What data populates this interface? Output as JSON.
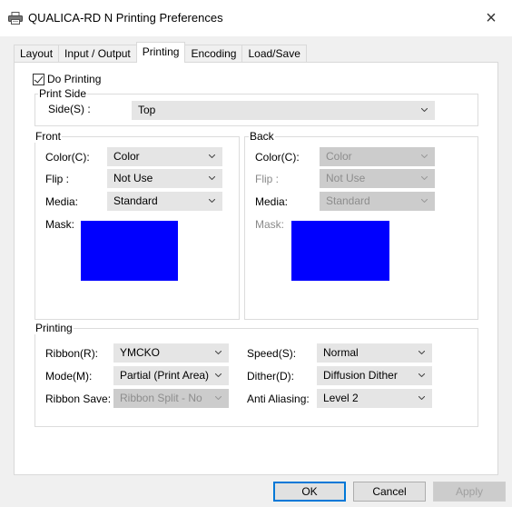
{
  "window": {
    "title": "QUALICA-RD N Printing Preferences",
    "icon": "printer-icon",
    "close_glyph": "×"
  },
  "tabs": [
    {
      "label": "Layout"
    },
    {
      "label": "Input / Output"
    },
    {
      "label": "Printing"
    },
    {
      "label": "Encoding"
    },
    {
      "label": "Load/Save"
    }
  ],
  "active_tab": "Printing",
  "do_printing": {
    "label": "Do Printing",
    "checked": true
  },
  "print_side": {
    "group_label": "Print Side",
    "side_label": "Side(S) :",
    "side_value": "Top"
  },
  "front": {
    "group_label": "Front",
    "color_label": "Color(C):",
    "color_value": "Color",
    "flip_label": "Flip :",
    "flip_value": "Not Use",
    "media_label": "Media:",
    "media_value": "Standard",
    "mask_label": "Mask:",
    "mask_color": "#0000ff"
  },
  "back": {
    "group_label": "Back",
    "color_label": "Color(C):",
    "color_value": "Color",
    "flip_label": "Flip :",
    "flip_value": "Not Use",
    "media_label": "Media:",
    "media_value": "Standard",
    "mask_label": "Mask:",
    "mask_color": "#0000ff"
  },
  "printing": {
    "group_label": "Printing",
    "ribbon_label": "Ribbon(R):",
    "ribbon_value": "YMCKO",
    "mode_label": "Mode(M):",
    "mode_value": "Partial (Print Area)",
    "ribbon_save_label": "Ribbon Save:",
    "ribbon_save_value": "Ribbon Split - No",
    "speed_label": "Speed(S):",
    "speed_value": "Normal",
    "dither_label": "Dither(D):",
    "dither_value": "Diffusion Dither",
    "anti_aliasing_label": "Anti Aliasing:",
    "anti_aliasing_value": "Level 2"
  },
  "buttons": {
    "ok": "OK",
    "cancel": "Cancel",
    "apply": "Apply"
  }
}
